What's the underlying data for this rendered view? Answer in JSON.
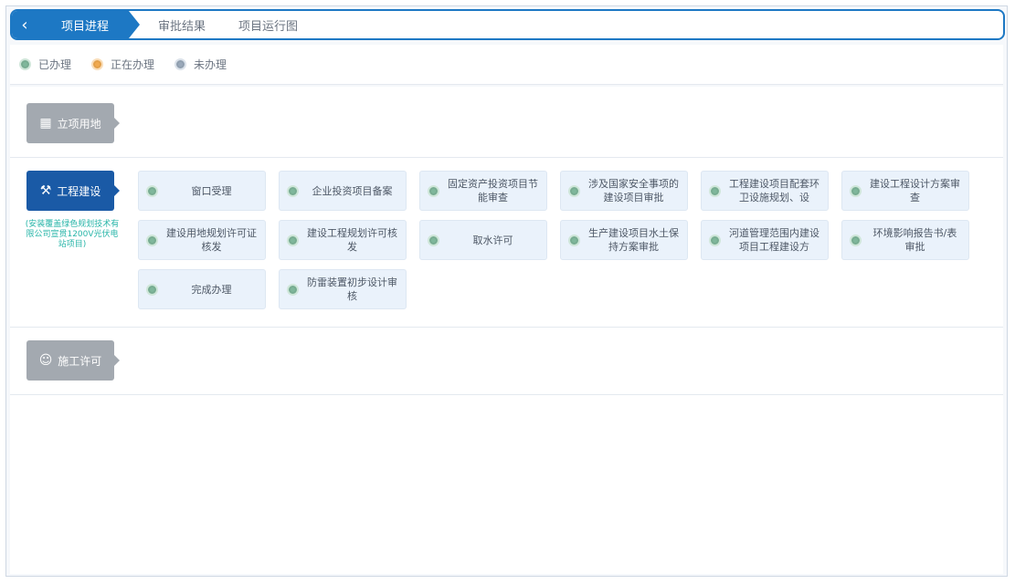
{
  "tabs": {
    "back_icon": "chevron-left-icon",
    "items": [
      {
        "label": "项目进程",
        "active": true
      },
      {
        "label": "审批结果",
        "active": false
      },
      {
        "label": "项目运行图",
        "active": false
      }
    ]
  },
  "legend": [
    {
      "label": "已办理",
      "status": "done"
    },
    {
      "label": "正在办理",
      "status": "doing"
    },
    {
      "label": "未办理",
      "status": "todo"
    }
  ],
  "colors": {
    "accent": "#1d78c4",
    "stage_active": "#1a5aa6",
    "stage_inactive": "#a3a9b0",
    "done": "#7fb79b",
    "doing": "#f1a94e",
    "todo": "#9aa9ba",
    "note": "#27b5a8"
  },
  "stages": [
    {
      "label": "立项用地",
      "icon": "building-icon",
      "active": false
    },
    {
      "label": "工程建设",
      "icon": "crane-icon",
      "active": true
    },
    {
      "label": "施工许可",
      "icon": "worker-icon",
      "active": false
    }
  ],
  "stage_note": "(安装覆盖绿色规划技术有限公司宣贯1200V光伏电站项目)",
  "items": [
    "窗口受理",
    "企业投资项目备案",
    "固定资产投资项目节能审查",
    "涉及国家安全事项的建设项目审批",
    "工程建设项目配套环卫设施规划、设",
    "建设工程设计方案审查",
    "建设用地规划许可证核发",
    "建设工程规划许可核发",
    "取水许可",
    "生产建设项目水土保持方案审批",
    "河道管理范围内建设项目工程建设方",
    "环境影响报告书/表审批",
    "完成办理",
    "防雷装置初步设计审核"
  ]
}
